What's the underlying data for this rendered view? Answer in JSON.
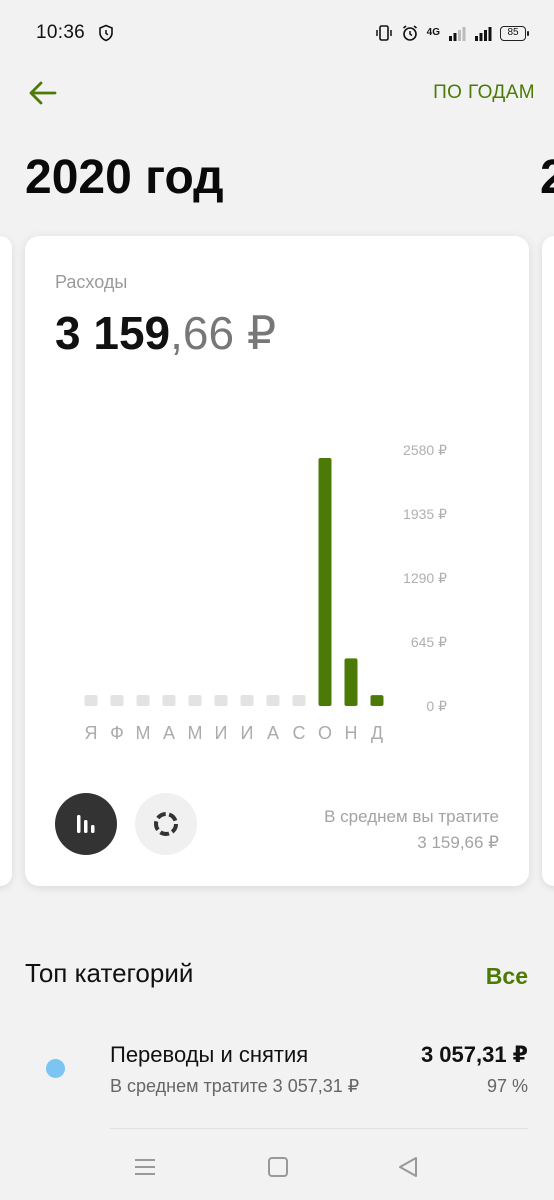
{
  "status_bar": {
    "time": "10:36",
    "network": "4G",
    "battery": "85"
  },
  "app_bar": {
    "back_icon": "arrow-left-icon",
    "by_years_label": "ПО ГОДАМ"
  },
  "year_title": "2020 год",
  "year_next_peek": "2",
  "expenses_card": {
    "label": "Расходы",
    "total_integer": "3 159",
    "total_fraction": ",66 ₽",
    "average_label": "В среднем вы тратите",
    "average_value": "3 159,66 ₽",
    "mode_buttons": [
      "bar-chart-icon",
      "donut-chart-icon"
    ]
  },
  "chart_data": {
    "type": "bar",
    "categories": [
      "Я",
      "Ф",
      "М",
      "А",
      "М",
      "И",
      "И",
      "А",
      "С",
      "О",
      "Н",
      "Д"
    ],
    "values": [
      0,
      0,
      0,
      0,
      0,
      0,
      0,
      0,
      0,
      2500,
      480,
      110
    ],
    "y_ticks": [
      "2580 ₽",
      "1935 ₽",
      "1290 ₽",
      "645 ₽",
      "0 ₽"
    ],
    "y_tick_values": [
      2580,
      1935,
      1290,
      645,
      0
    ],
    "ylim": [
      0,
      2580
    ],
    "title": "",
    "xlabel": "",
    "ylabel": "",
    "colors": {
      "bar": "#4c7a06",
      "empty_bar": "#e3e3e3"
    }
  },
  "top_categories": {
    "title": "Топ категорий",
    "all_label": "Все",
    "items": [
      {
        "name": "Переводы и снятия",
        "amount": "3 057,31 ₽",
        "subtitle": "В среднем тратите 3 057,31 ₽",
        "percent": "97 %",
        "color": "#7cc4f2"
      }
    ]
  },
  "nav_bar": {
    "icons": [
      "menu-icon",
      "home-icon",
      "back-icon"
    ]
  },
  "colors": {
    "accent": "#4c7a06",
    "background": "#f2f2f2"
  }
}
